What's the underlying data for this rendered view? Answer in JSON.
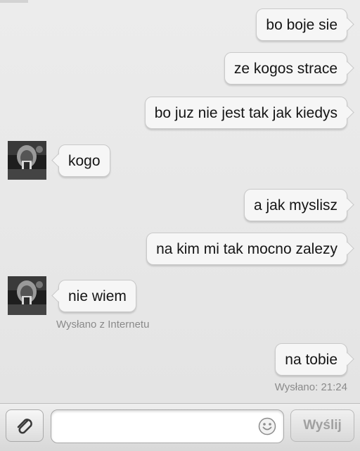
{
  "messages": [
    {
      "text": "bo boje sie"
    },
    {
      "text": "ze kogos strace"
    },
    {
      "text": "bo juz nie jest tak jak kiedys"
    },
    {
      "text": "kogo"
    },
    {
      "text": "a jak myslisz"
    },
    {
      "text": "na kim mi tak mocno zalezy"
    },
    {
      "text": "nie wiem"
    },
    {
      "text": "na tobie"
    }
  ],
  "statuses": {
    "incoming_source": "Wysłano z Internetu",
    "sent_time": "Wysłano: 21:24"
  },
  "composer": {
    "attach_icon": "paperclip-icon",
    "emoji_icon": "smiley-icon",
    "input_value": "",
    "send_label": "Wyślij"
  },
  "colors": {
    "background": "#e9e9e9",
    "bubble": "#f6f6f6",
    "bubble_border": "#c9c9c9",
    "status_text": "#8a8a8a",
    "send_disabled_text": "#a0a0a0"
  }
}
